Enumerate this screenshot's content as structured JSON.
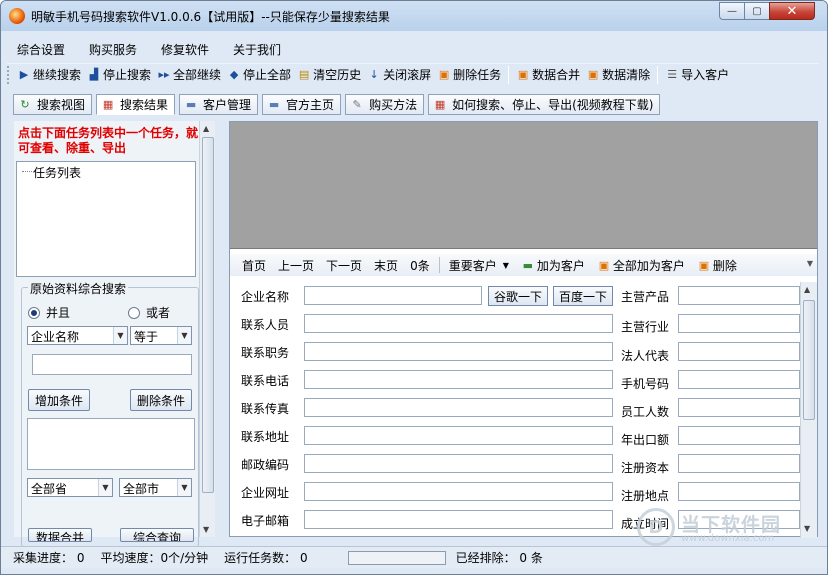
{
  "window": {
    "title": "明敏手机号码搜索软件V1.0.0.6【试用版】--只能保存少量搜索结果",
    "min_label": "—",
    "max_label": "▢",
    "close_label": "✕"
  },
  "menu": [
    "综合设置",
    "购买服务",
    "修复软件",
    "关于我们"
  ],
  "toolbar": {
    "continue_search": "继续搜索",
    "stop_search": "停止搜索",
    "continue_all": "全部继续",
    "stop_all": "停止全部",
    "clear_history": "清空历史",
    "close_scroll": "关闭滚屏",
    "delete_task": "删除任务",
    "merge_data": "数据合并",
    "clear_data": "数据清除",
    "import_customers": "导入客户"
  },
  "tabs": {
    "search_view": "搜索视图",
    "search_results": "搜索结果",
    "customer_mgmt": "客户管理",
    "homepage": "官方主页",
    "purchase": "购买方法",
    "howto": "如何搜索、停止、导出(视频教程下载)"
  },
  "left": {
    "hint": "点击下面任务列表中一个任务，就可查看、除重、导出",
    "tree_root": "任务列表",
    "group_title": "原始资料综合搜索",
    "radio_and": "并且",
    "radio_or": "或者",
    "field_select": "企业名称",
    "op_select": "等于",
    "add_condition": "增加条件",
    "delete_condition": "删除条件",
    "province_select": "全部省",
    "city_select": "全部市",
    "merge_btn": "数据合并",
    "combined_query": "综合查询"
  },
  "nav": {
    "first": "首页",
    "prev": "上一页",
    "next": "下一页",
    "last": "末页",
    "count": "0条",
    "important": "重要客户",
    "add_customer": "加为客户",
    "add_all": "全部加为客户",
    "delete": "删除"
  },
  "form": {
    "company_name": "企业名称",
    "google_btn": "谷歌一下",
    "baidu_btn": "百度一下",
    "main_product": "主营产品",
    "contact_person": "联系人员",
    "main_industry": "主营行业",
    "contact_title": "联系职务",
    "legal_rep": "法人代表",
    "contact_phone": "联系电话",
    "mobile": "手机号码",
    "contact_fax": "联系传真",
    "employees": "员工人数",
    "contact_address": "联系地址",
    "annual_export": "年出口额",
    "postal_code": "邮政编码",
    "reg_capital": "注册资本",
    "company_website": "企业网址",
    "reg_location": "注册地点",
    "email": "电子邮箱",
    "founded": "成立时间"
  },
  "status": {
    "progress": "采集进度： 0",
    "avg_speed": "平均速度：0个/分钟",
    "running": "运行任务数： 0",
    "removed": "已经排除：  0  条"
  },
  "watermark": {
    "text": "当下软件园",
    "url": "www.downxia.com"
  }
}
